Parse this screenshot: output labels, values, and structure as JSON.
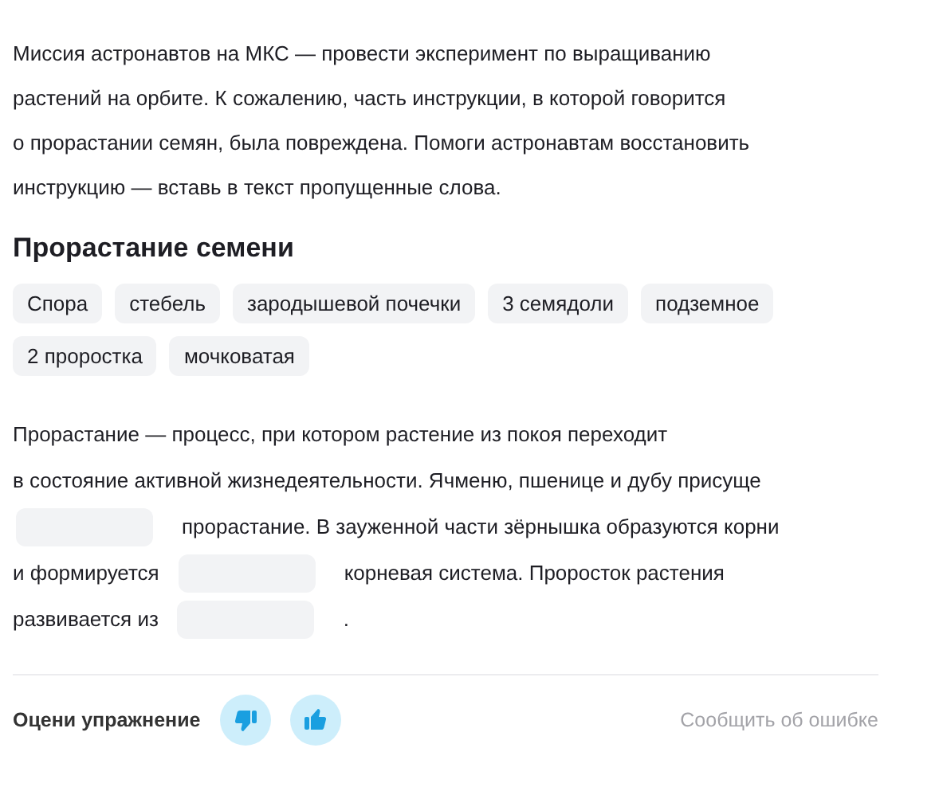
{
  "intro": [
    "Миссия астронавтов на МКС — провести эксперимент по выращиванию",
    "растений на орбите. К сожалению, часть инструкции, в которой говорится",
    "о прорастании семян, была повреждена. Помоги астронавтам восстановить",
    "инструкцию — вставь в текст пропущенные слова."
  ],
  "heading": "Прорастание семени",
  "options": [
    "Спора",
    "стебель",
    "зародышевой почечки",
    "3 семядоли",
    "подземное",
    "2 проростка",
    "мочковатая"
  ],
  "lines": [
    [
      {
        "kind": "text",
        "text": "Прорастание — процесс, при котором растение из покоя переходит"
      }
    ],
    [
      {
        "kind": "text",
        "text": "в состояние активной жизнедеятельности. Ячменю, пшенице и дубу присуще"
      }
    ],
    [
      {
        "kind": "blank"
      },
      {
        "kind": "text",
        "text": "прорастание. В зауженной части зёрнышка образуются корни"
      }
    ],
    [
      {
        "kind": "text",
        "text": "и формируется"
      },
      {
        "kind": "blank"
      },
      {
        "kind": "text",
        "text": "корневая система. Проросток растения"
      }
    ],
    [
      {
        "kind": "text",
        "text": "развивается из"
      },
      {
        "kind": "blank"
      },
      {
        "kind": "text",
        "text": "."
      }
    ]
  ],
  "footer": {
    "rate_label": "Оцени упражнение",
    "report_link": "Сообщить об ошибке"
  }
}
